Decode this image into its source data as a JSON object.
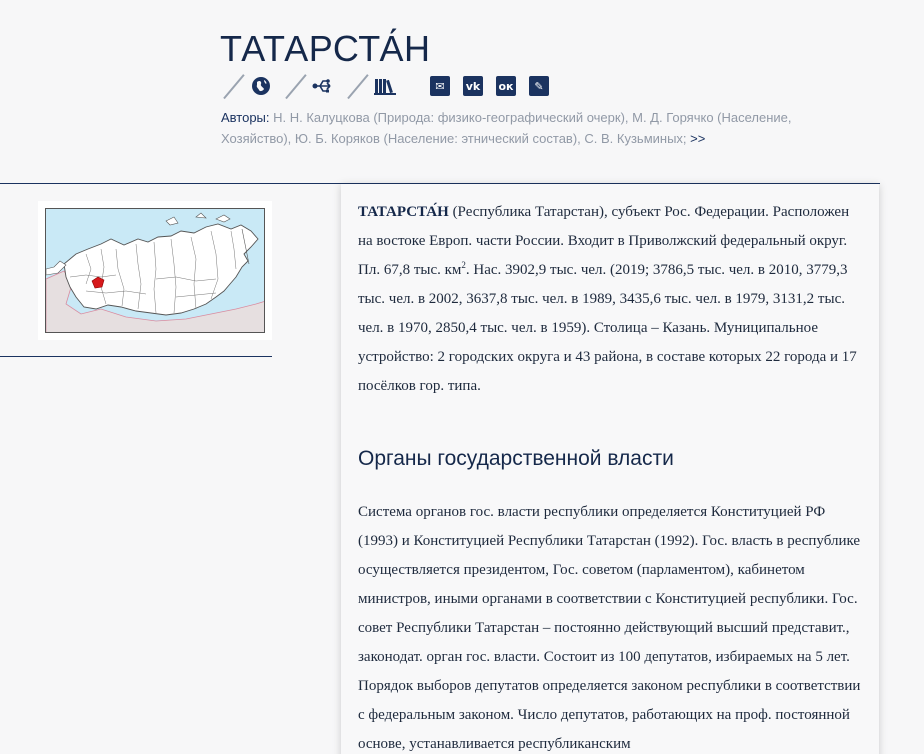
{
  "page": {
    "title": "ТАТАРСТА́Н"
  },
  "toolbar": {
    "icons": [
      "globe-icon",
      "share-icon",
      "library-icon"
    ],
    "social": [
      "mail-icon",
      "vk-icon",
      "odnoklassniki-icon",
      "livejournal-icon"
    ],
    "social_glyphs": {
      "mail": "✉",
      "vk": "vk",
      "ok": "ок",
      "lj": "✎"
    }
  },
  "authors": {
    "label": "Авторы:",
    "text": " Н. Н. Калуцкова (Природа: физико-географический очерк), М. Д. Горячко (Население, Хозяйство), Ю. Б. Коряков (Население: этнический состав), С. В. Кузьминых; ",
    "more": ">>"
  },
  "article": {
    "intro_term": "ТАТАРСТА́Н",
    "intro_line1": " (Республика Татарстан), субъект Рос. Федерации. Расположен на востоке Европ. части России. Входит в Приволжский федеральный ок­руг. Пл. 67,8 тыс. км",
    "intro_sup": "2",
    "intro_line2": ". Нас. 3902,9 тыс. чел. (2019; 3786,5 тыс. чел. в 2010, 3779,3 тыс. чел. в 2002, 3637,8 тыс. чел. в 1989, 3435,6 тыс. чел. в 1979, 3131,2 тыс. чел. в 1970, 2850,4 тыс. чел. в 1959). Столица – Казань. Муниципальное устройство: 2 городских округа и 43 района, в составе которых 22 города и 17 посёлков гор. типа.",
    "section_heading": "Органы государственной власти",
    "section_text": "Система органов гос. власти республики определяется Конституцией РФ (1993) и Конституцией Республики Татарстан (1992). Гос. власть в респуб­лике осуществляется президентом, Гос. советом (парламентом), кабине­том министров, иными органами в соответствии с Конституцией респуб­лики. Гос. совет Республики Татарстан – постоянно действующий высший представит., законодат. орган гос. власти. Состоит из 100 депутатов, изби­раемых на 5 лет. Порядок выборов депутатов определяется законом рес­публики в соответствии с федеральным законом. Число депутатов, рабо­тающих на проф. постоянной основе, устанавливается республиканским"
  },
  "colors": {
    "accent": "#1b3360",
    "region_highlight": "#d7191c",
    "sea": "#c9e9f6"
  }
}
